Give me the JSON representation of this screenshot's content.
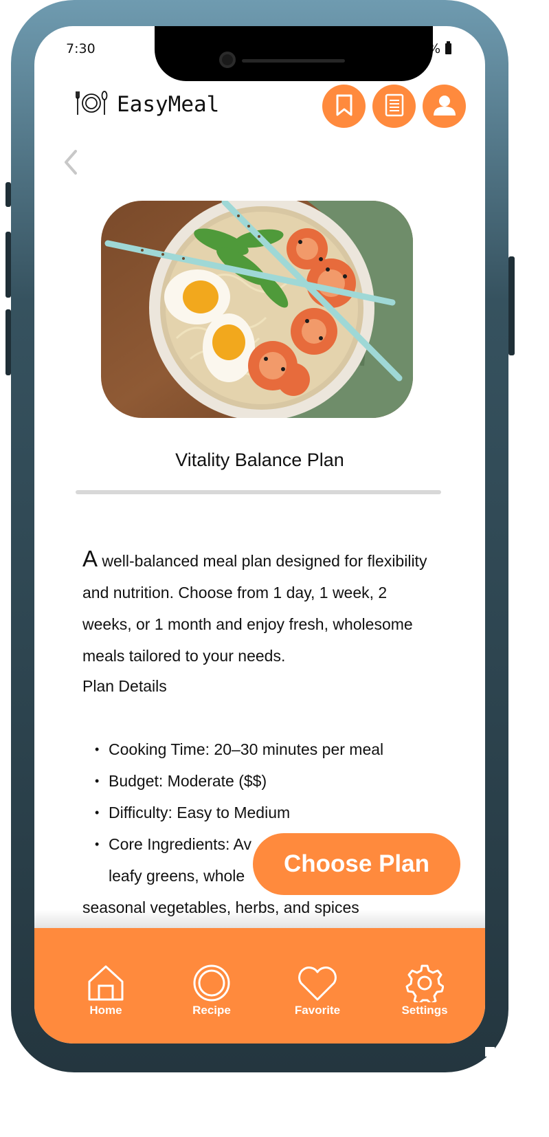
{
  "status_bar": {
    "time": "7:30",
    "battery": "80%"
  },
  "header": {
    "app_name": "EasyMeal",
    "icons": [
      "bookmark-icon",
      "document-icon",
      "profile-icon"
    ]
  },
  "plan": {
    "title": "Vitality Balance Plan",
    "intro_dropcap": "A",
    "intro_rest": " well-balanced meal plan designed for flexibility and nutrition. Choose from 1 day, 1 week, 2 weeks, or 1 month and enjoy fresh, wholesome meals tailored to your needs.",
    "details_heading": "Plan Details",
    "details": [
      "Cooking Time: 20–30 minutes per meal",
      "Budget: Moderate ($$)",
      "Difficulty: Easy to Medium"
    ],
    "core_ingredients_line1": "Core Ingredients: Av",
    "core_ingredients_line2": "leafy greens, whole",
    "core_ingredients_line3": "seasonal vegetables, herbs, and spices"
  },
  "cta": {
    "choose_plan": "Choose Plan"
  },
  "bottom_nav": {
    "home": "Home",
    "recipe": "Recipe",
    "favorite": "Favorite",
    "settings": "Settings"
  },
  "colors": {
    "accent": "#ff8a3d",
    "text": "#111111",
    "divider": "#d8d8d8"
  }
}
